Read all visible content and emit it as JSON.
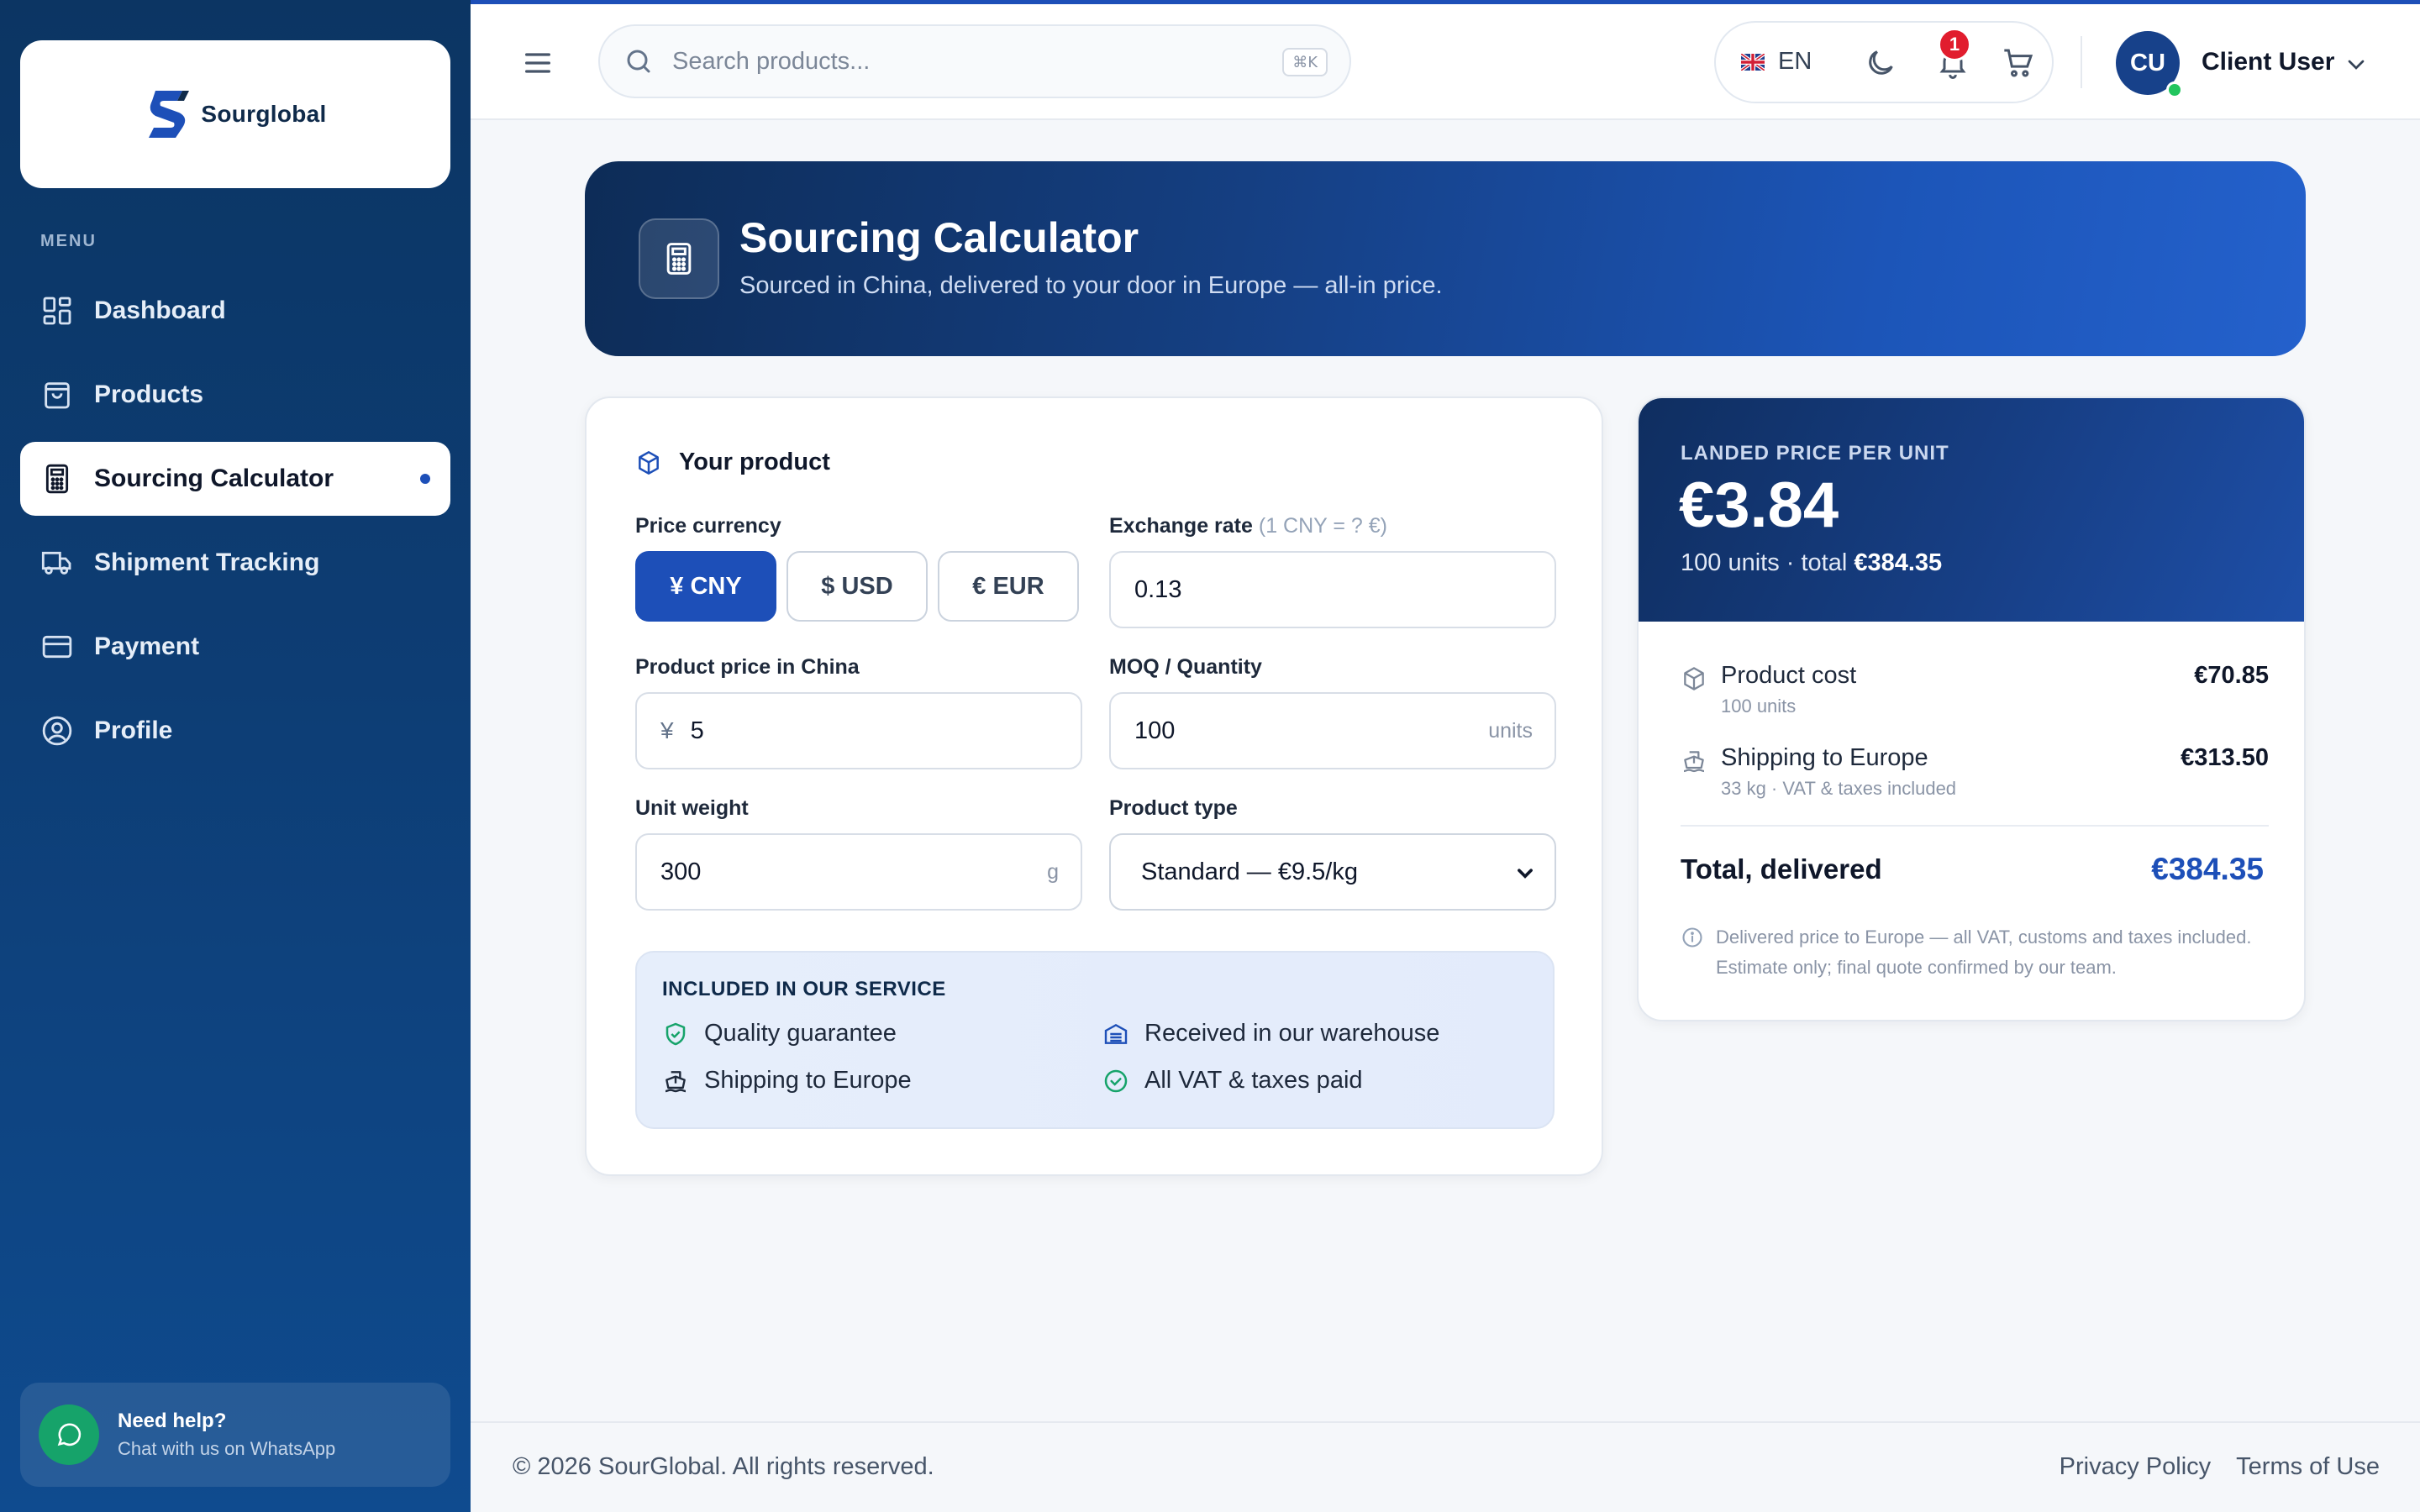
{
  "brand": {
    "name": "Sourglobal"
  },
  "sidebar": {
    "menu_label": "MENU",
    "items": [
      {
        "label": "Dashboard",
        "icon": "dashboard-icon"
      },
      {
        "label": "Products",
        "icon": "bag-icon"
      },
      {
        "label": "Sourcing Calculator",
        "icon": "calculator-icon",
        "active": true
      },
      {
        "label": "Shipment Tracking",
        "icon": "truck-icon"
      },
      {
        "label": "Payment",
        "icon": "credit-card-icon"
      },
      {
        "label": "Profile",
        "icon": "user-circle-icon"
      }
    ],
    "help": {
      "title": "Need help?",
      "subtitle": "Chat with us on WhatsApp"
    }
  },
  "topbar": {
    "search_placeholder": "Search products...",
    "shortcut": "⌘K",
    "language": "EN",
    "notification_count": "1",
    "user": {
      "initials": "CU",
      "name": "Client User"
    }
  },
  "hero": {
    "title": "Sourcing Calculator",
    "subtitle": "Sourced in China, delivered to your door in Europe — all-in price."
  },
  "form": {
    "heading": "Your product",
    "price_currency_label": "Price currency",
    "currencies": [
      "¥ CNY",
      "$ USD",
      "€ EUR"
    ],
    "selected_currency": "¥ CNY",
    "exchange_rate_label": "Exchange rate",
    "exchange_rate_hint": "(1 CNY = ? €)",
    "exchange_rate_value": "0.13",
    "price_label": "Product price in China",
    "price_prefix": "¥",
    "price_value": "5",
    "moq_label": "MOQ / Quantity",
    "moq_value": "100",
    "moq_unit": "units",
    "weight_label": "Unit weight",
    "weight_value": "300",
    "weight_unit": "g",
    "type_label": "Product type",
    "type_value": "Standard — €9.5/kg",
    "included_title": "INCLUDED IN OUR SERVICE",
    "included": [
      "Quality guarantee",
      "Received in our warehouse",
      "Shipping to Europe",
      "All VAT & taxes paid"
    ]
  },
  "summary": {
    "label": "LANDED PRICE PER UNIT",
    "unit_price": "€3.84",
    "units_text": "100 units · total",
    "total_short": "€384.35",
    "lines": [
      {
        "name": "Product cost",
        "meta": "100 units",
        "amount": "€70.85"
      },
      {
        "name": "Shipping to Europe",
        "meta": "33 kg · VAT & taxes included",
        "amount": "€313.50"
      }
    ],
    "total_label": "Total, delivered",
    "total_amount": "€384.35",
    "note": "Delivered price to Europe — all VAT, customs and taxes included. Estimate only; final quote confirmed by our team."
  },
  "footer": {
    "copyright": "© 2026 SourGlobal. All rights reserved.",
    "links": [
      "Privacy Policy",
      "Terms of Use"
    ]
  },
  "colors": {
    "accent": "#1d4fb8",
    "sidebar": "#0d3d74",
    "success": "#16a36a",
    "danger": "#e11d2e"
  }
}
